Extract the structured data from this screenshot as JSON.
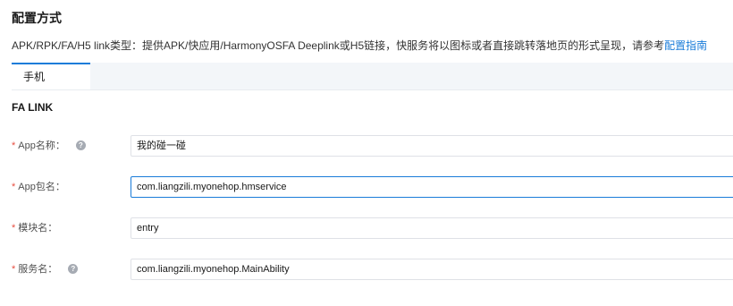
{
  "section": {
    "title": "配置方式",
    "description": "APK/RPK/FA/H5 link类型：提供APK/快应用/HarmonyOSFA Deeplink或H5链接，快服务将以图标或者直接跳转落地页的形式呈现，请参考",
    "guide_link": "配置指南"
  },
  "tabs": [
    {
      "label": "手机",
      "active": true
    }
  ],
  "fa_link": {
    "title": "FA LINK",
    "fields": [
      {
        "required_mark": "*",
        "label": "App名称：",
        "help": true,
        "value": "我的碰一碰",
        "focused": false
      },
      {
        "required_mark": "*",
        "label": "App包名：",
        "help": false,
        "value": "com.liangzili.myonehop.hmservice",
        "focused": true
      },
      {
        "required_mark": "*",
        "label": "模块名：",
        "help": false,
        "value": "entry",
        "focused": false
      },
      {
        "required_mark": "*",
        "label": "服务名：",
        "help": true,
        "value": "com.liangzili.myonehop.MainAbility",
        "focused": false
      }
    ]
  },
  "icons": {
    "help": "question-circle-icon",
    "help_glyph": "?"
  },
  "colors": {
    "accent": "#1a7cd9",
    "required": "#e84e40",
    "tab_bar_bg": "#f3f6f9"
  }
}
